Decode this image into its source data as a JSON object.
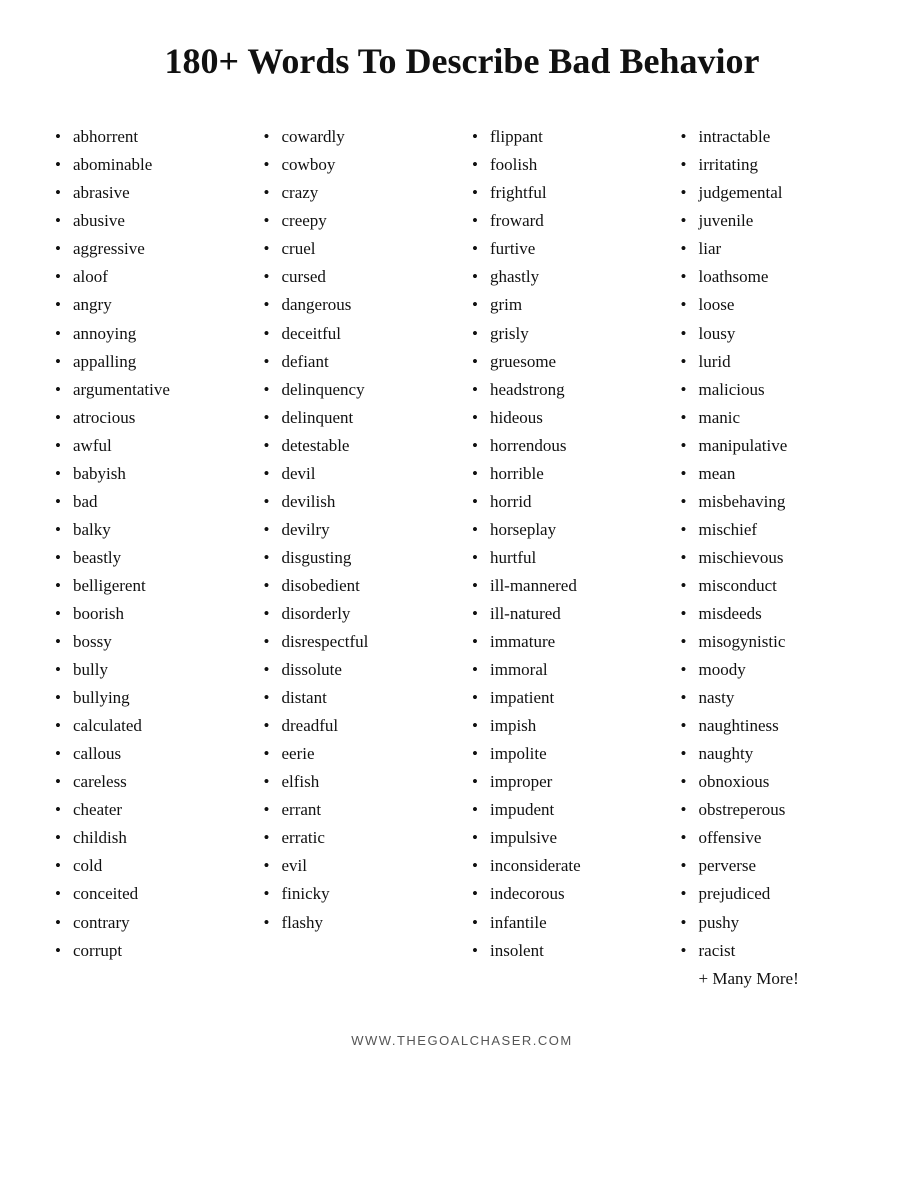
{
  "title": "180+ Words To Describe Bad Behavior",
  "columns": [
    {
      "id": "col1",
      "items": [
        "abhorrent",
        "abominable",
        "abrasive",
        "abusive",
        "aggressive",
        "aloof",
        "angry",
        "annoying",
        "appalling",
        "argumentative",
        "atrocious",
        "awful",
        "babyish",
        "bad",
        "balky",
        "beastly",
        "belligerent",
        "boorish",
        "bossy",
        "bully",
        "bullying",
        "calculated",
        "callous",
        "careless",
        "cheater",
        "childish",
        "cold",
        "conceited",
        "contrary",
        "corrupt"
      ]
    },
    {
      "id": "col2",
      "items": [
        "cowardly",
        "cowboy",
        "crazy",
        "creepy",
        "cruel",
        "cursed",
        "dangerous",
        "deceitful",
        "defiant",
        "delinquency",
        "delinquent",
        "detestable",
        "devil",
        "devilish",
        "devilry",
        "disgusting",
        "disobedient",
        "disorderly",
        "disrespectful",
        "dissolute",
        "distant",
        "dreadful",
        "eerie",
        "elfish",
        "errant",
        "erratic",
        "evil",
        "finicky",
        "flashy"
      ]
    },
    {
      "id": "col3",
      "items": [
        "flippant",
        "foolish",
        "frightful",
        "froward",
        "furtive",
        "ghastly",
        "grim",
        "grisly",
        "gruesome",
        "headstrong",
        "hideous",
        "horrendous",
        "horrible",
        "horrid",
        "horseplay",
        "hurtful",
        "ill-mannered",
        "ill-natured",
        "immature",
        "immoral",
        "impatient",
        "impish",
        "impolite",
        "improper",
        "impudent",
        "impulsive",
        "inconsiderate",
        "indecorous",
        "infantile",
        "insolent"
      ]
    },
    {
      "id": "col4",
      "items": [
        "intractable",
        "irritating",
        "judgemental",
        "juvenile",
        "liar",
        "loathsome",
        "loose",
        "lousy",
        "lurid",
        "malicious",
        "manic",
        "manipulative",
        "mean",
        "misbehaving",
        "mischief",
        "mischievous",
        "misconduct",
        "misdeeds",
        "misogynistic",
        "moody",
        "nasty",
        "naughtiness",
        "naughty",
        "obnoxious",
        "obstreperous",
        "offensive",
        "perverse",
        "prejudiced",
        "pushy",
        "racist"
      ]
    }
  ],
  "extra": "+ Many More!",
  "footer": "WWW.THEGOALCHASER.COM"
}
